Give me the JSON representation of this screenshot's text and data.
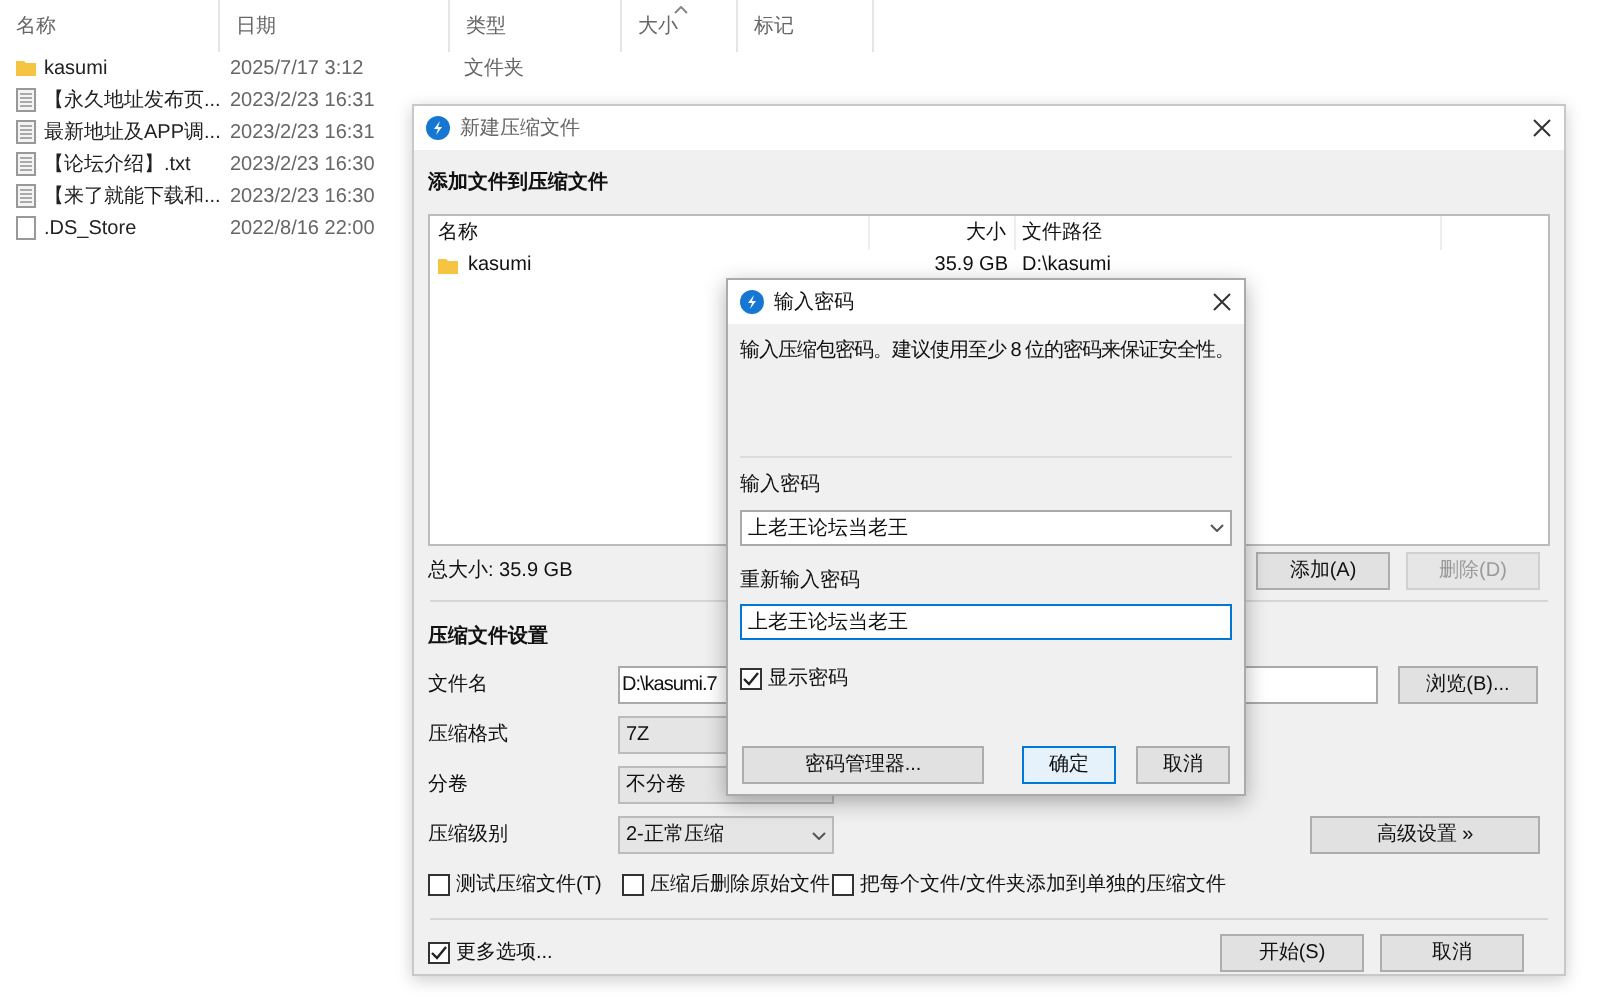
{
  "explorer": {
    "columns": [
      {
        "label": "名称",
        "sorted": false
      },
      {
        "label": "日期",
        "sorted": false
      },
      {
        "label": "类型",
        "sorted": false
      },
      {
        "label": "大小",
        "sorted": true
      },
      {
        "label": "标记",
        "sorted": false
      }
    ],
    "rows": [
      {
        "kind": "folder",
        "name": "kasumi",
        "date": "2025/7/17 3:12",
        "type": "文件夹"
      },
      {
        "kind": "file",
        "name": "【永久地址发布页...",
        "date": "2023/2/23 16:31"
      },
      {
        "kind": "file",
        "name": "最新地址及APP调...",
        "date": "2023/2/23 16:31"
      },
      {
        "kind": "file",
        "name": "【论坛介绍】.txt",
        "date": "2023/2/23 16:30"
      },
      {
        "kind": "file",
        "name": "【来了就能下载和...",
        "date": "2023/2/23 16:30"
      },
      {
        "kind": "blank",
        "name": ".DS_Store",
        "date": "2022/8/16 22:00"
      }
    ]
  },
  "compress_dialog": {
    "title": "新建压缩文件",
    "section_label": "添加文件到压缩文件",
    "file_list": {
      "columns": [
        "名称",
        "大小",
        "文件路径"
      ],
      "rows": [
        {
          "name": "kasumi",
          "size": "35.9 GB",
          "path": "D:\\kasumi"
        }
      ]
    },
    "total_size": "总大小: 35.9 GB",
    "list_buttons": [
      {
        "label": "添加(A)",
        "disabled": false
      },
      {
        "label": "删除(D)",
        "disabled": true
      }
    ],
    "settings_label": "压缩文件设置",
    "fields": [
      {
        "label": "文件名",
        "kind": "input",
        "value": "D:\\kasumi.7"
      },
      {
        "label": "压缩格式",
        "kind": "select",
        "value": "7Z"
      },
      {
        "label": "分卷",
        "kind": "select",
        "value": "不分卷"
      },
      {
        "label": "压缩级别",
        "kind": "select",
        "value": "2-正常压缩"
      }
    ],
    "browse_button": "浏览(B)...",
    "advanced_button": "高级设置 »",
    "options": [
      {
        "label": "测试压缩文件(T)",
        "checked": false
      },
      {
        "label": "压缩后删除原始文件",
        "checked": false
      },
      {
        "label": "把每个文件/文件夹添加到单独的压缩文件",
        "checked": false
      }
    ],
    "more_options": {
      "label": "更多选项...",
      "checked": true
    },
    "buttons": [
      "开始(S)",
      "取消"
    ]
  },
  "password_dialog": {
    "title": "输入密码",
    "hint": "输入压缩包密码。建议使用至少 8 位的密码来保证安全性。",
    "password_label": "输入密码",
    "password_value": "上老王论坛当老王",
    "confirm_label": "重新输入密码",
    "confirm_value": "上老王论坛当老王",
    "show_password": {
      "label": "显示密码",
      "checked": true
    },
    "manager_button": "密码管理器...",
    "buttons": [
      {
        "label": "确定",
        "default": true
      },
      {
        "label": "取消",
        "default": false
      }
    ]
  }
}
